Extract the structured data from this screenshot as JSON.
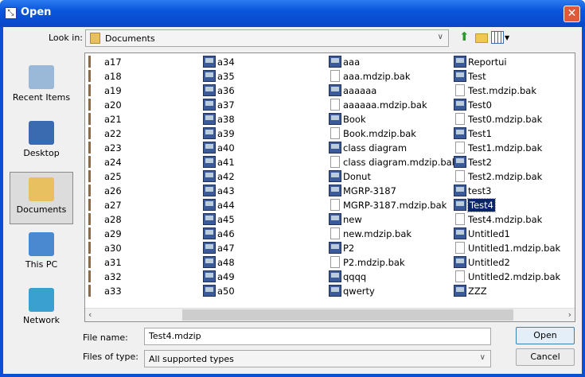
{
  "title": "Open",
  "look_in": {
    "label": "Look in:",
    "value": "Documents"
  },
  "places": [
    {
      "label": "Recent Items"
    },
    {
      "label": "Desktop"
    },
    {
      "label": "Documents",
      "selected": true
    },
    {
      "label": "This PC"
    },
    {
      "label": "Network"
    }
  ],
  "columns": [
    [
      {
        "n": "a17",
        "t": "t"
      },
      {
        "n": "a18",
        "t": "t"
      },
      {
        "n": "a19",
        "t": "t"
      },
      {
        "n": "a20",
        "t": "t"
      },
      {
        "n": "a21",
        "t": "t"
      },
      {
        "n": "a22",
        "t": "t"
      },
      {
        "n": "a23",
        "t": "t"
      },
      {
        "n": "a24",
        "t": "t"
      },
      {
        "n": "a25",
        "t": "t"
      },
      {
        "n": "a26",
        "t": "t"
      },
      {
        "n": "a27",
        "t": "t"
      },
      {
        "n": "a28",
        "t": "t"
      },
      {
        "n": "a29",
        "t": "t"
      },
      {
        "n": "a30",
        "t": "t"
      },
      {
        "n": "a31",
        "t": "t"
      },
      {
        "n": "a32",
        "t": "t"
      },
      {
        "n": "a33",
        "t": "t"
      }
    ],
    [
      {
        "n": "a34",
        "t": "m"
      },
      {
        "n": "a35",
        "t": "m"
      },
      {
        "n": "a36",
        "t": "m"
      },
      {
        "n": "a37",
        "t": "m"
      },
      {
        "n": "a38",
        "t": "m"
      },
      {
        "n": "a39",
        "t": "m"
      },
      {
        "n": "a40",
        "t": "m"
      },
      {
        "n": "a41",
        "t": "m"
      },
      {
        "n": "a42",
        "t": "m"
      },
      {
        "n": "a43",
        "t": "m"
      },
      {
        "n": "a44",
        "t": "m"
      },
      {
        "n": "a45",
        "t": "m"
      },
      {
        "n": "a46",
        "t": "m"
      },
      {
        "n": "a47",
        "t": "m"
      },
      {
        "n": "a48",
        "t": "m"
      },
      {
        "n": "a49",
        "t": "m"
      },
      {
        "n": "a50",
        "t": "m"
      }
    ],
    [
      {
        "n": "aaa",
        "t": "m"
      },
      {
        "n": "aaa.mdzip.bak",
        "t": "b"
      },
      {
        "n": "aaaaaa",
        "t": "m"
      },
      {
        "n": "aaaaaa.mdzip.bak",
        "t": "b"
      },
      {
        "n": "Book",
        "t": "m"
      },
      {
        "n": "Book.mdzip.bak",
        "t": "b"
      },
      {
        "n": "class diagram",
        "t": "m"
      },
      {
        "n": "class diagram.mdzip.bak",
        "t": "b"
      },
      {
        "n": "Donut",
        "t": "m"
      },
      {
        "n": "MGRP-3187",
        "t": "m"
      },
      {
        "n": "MGRP-3187.mdzip.bak",
        "t": "b"
      },
      {
        "n": "new",
        "t": "m"
      },
      {
        "n": "new.mdzip.bak",
        "t": "b"
      },
      {
        "n": "P2",
        "t": "m"
      },
      {
        "n": "P2.mdzip.bak",
        "t": "b"
      },
      {
        "n": "qqqq",
        "t": "m"
      },
      {
        "n": "qwerty",
        "t": "m"
      }
    ],
    [
      {
        "n": "Reportui",
        "t": "m"
      },
      {
        "n": "Test",
        "t": "m"
      },
      {
        "n": "Test.mdzip.bak",
        "t": "b"
      },
      {
        "n": "Test0",
        "t": "m"
      },
      {
        "n": "Test0.mdzip.bak",
        "t": "b"
      },
      {
        "n": "Test1",
        "t": "m"
      },
      {
        "n": "Test1.mdzip.bak",
        "t": "b"
      },
      {
        "n": "Test2",
        "t": "m"
      },
      {
        "n": "Test2.mdzip.bak",
        "t": "b"
      },
      {
        "n": "test3",
        "t": "m"
      },
      {
        "n": "Test4",
        "t": "m",
        "selected": true
      },
      {
        "n": "Test4.mdzip.bak",
        "t": "b"
      },
      {
        "n": "Untitled1",
        "t": "m"
      },
      {
        "n": "Untitled1.mdzip.bak",
        "t": "b"
      },
      {
        "n": "Untitled2",
        "t": "m"
      },
      {
        "n": "Untitled2.mdzip.bak",
        "t": "b"
      },
      {
        "n": "ZZZ",
        "t": "m"
      }
    ]
  ],
  "file_name": {
    "label": "File name:",
    "value": "Test4.mdzip"
  },
  "file_type": {
    "label": "Files of type:",
    "value": "All supported types"
  },
  "buttons": {
    "open": "Open",
    "cancel": "Cancel"
  },
  "close_glyph": "✕"
}
